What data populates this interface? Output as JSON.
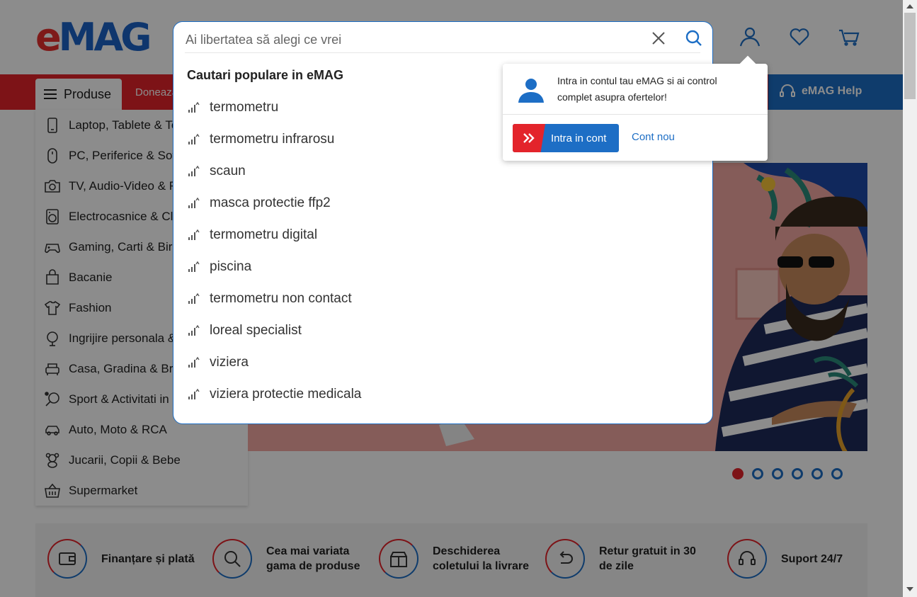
{
  "header": {
    "logo_e": "e",
    "logo_rest": "MAG",
    "icons": [
      "account-icon",
      "favorites-heart-icon",
      "cart-icon"
    ]
  },
  "nav": {
    "products_label": "Produse",
    "donate_label": "Doneaza",
    "help_label": "eMAG Help"
  },
  "categories": [
    {
      "label": "Laptop, Tablete & Telefoane",
      "icon": "phone-icon"
    },
    {
      "label": "PC, Periferice & Software",
      "icon": "mouse-icon"
    },
    {
      "label": "TV, Audio-Video & Foto",
      "icon": "camera-icon"
    },
    {
      "label": "Electrocasnice & Climatizare",
      "icon": "washing-machine-icon"
    },
    {
      "label": "Gaming, Carti & Birotica",
      "icon": "gamepad-icon"
    },
    {
      "label": "Bacanie",
      "icon": "shopping-bag-icon"
    },
    {
      "label": "Fashion",
      "icon": "tshirt-icon"
    },
    {
      "label": "Ingrijire personala & Cosmetice",
      "icon": "mirror-icon"
    },
    {
      "label": "Casa, Gradina & Bricolaj",
      "icon": "armchair-icon"
    },
    {
      "label": "Sport & Activitati in aer liber",
      "icon": "racket-icon"
    },
    {
      "label": "Auto, Moto & RCA",
      "icon": "car-icon"
    },
    {
      "label": "Jucarii, Copii & Bebe",
      "icon": "teddy-bear-icon"
    },
    {
      "label": "Supermarket",
      "icon": "basket-icon"
    }
  ],
  "search": {
    "placeholder": "Ai libertatea să alegi ce vrei",
    "heading": "Cautari populare in eMAG",
    "suggestions": [
      "termometru",
      "termometru infrarosu",
      "scaun",
      "masca protectie ffp2",
      "termometru digital",
      "piscina",
      "termometru non contact",
      "loreal specialist",
      "viziera",
      "viziera protectie medicala"
    ]
  },
  "account_popover": {
    "message": "Intra in contul tau eMAG si ai control complet asupra ofertelor!",
    "login_label": "Intra in cont",
    "new_account_label": "Cont nou"
  },
  "carousel": {
    "slides": 6,
    "active_index": 0
  },
  "benefits": [
    {
      "label": "Finanțare și plată",
      "icon": "wallet-icon"
    },
    {
      "label": "Cea mai variata gama de produse",
      "icon": "magnifier-icon"
    },
    {
      "label": "Deschiderea coletului la livrare",
      "icon": "open-box-icon"
    },
    {
      "label": "Retur gratuit in 30 de zile",
      "icon": "return-arrow-icon"
    },
    {
      "label": "Suport 24/7",
      "icon": "headset-icon"
    }
  ],
  "colors": {
    "brand_red": "#e3242b",
    "brand_blue": "#1d6ec5"
  }
}
